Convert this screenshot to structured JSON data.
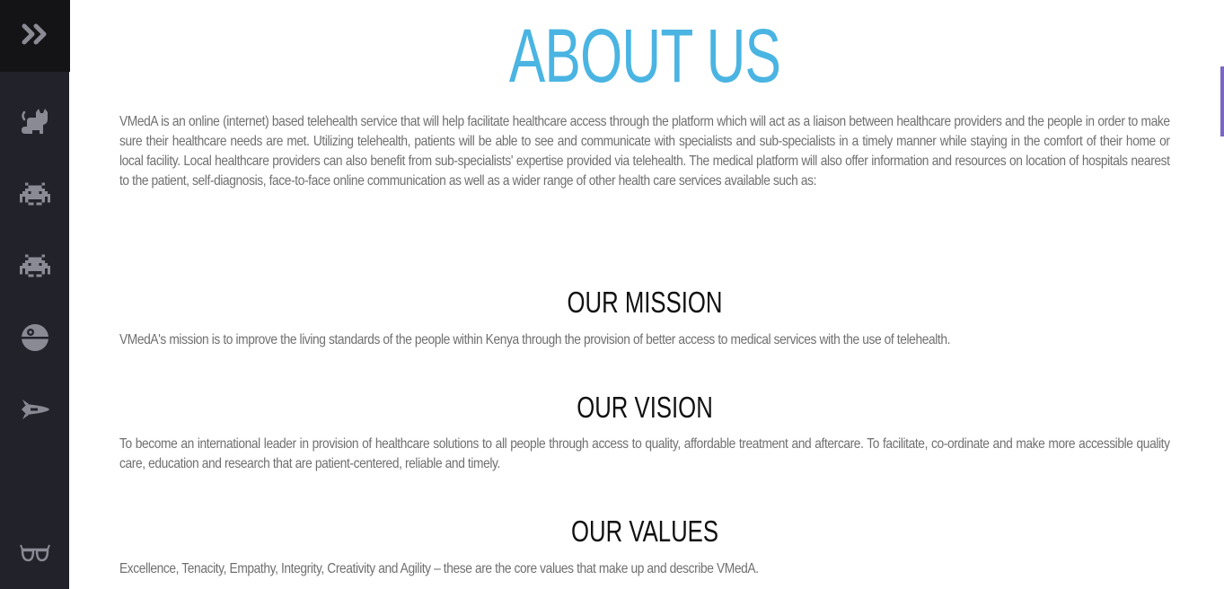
{
  "sidebar": {
    "toggle_icon": "double-chevron-right-icon",
    "items": [
      {
        "name": "cat-icon"
      },
      {
        "name": "space-invader-icon"
      },
      {
        "name": "space-invader-icon"
      },
      {
        "name": "death-star-icon"
      },
      {
        "name": "spaceship-icon"
      },
      {
        "name": "glasses-icon"
      }
    ]
  },
  "page": {
    "title": "ABOUT US",
    "intro": "VMedA is an online (internet) based telehealth service that will help facilitate healthcare access through the platform which will act as a liaison between healthcare providers and the people in order to make sure their healthcare needs are met. Utilizing telehealth, patients will be able to see and communicate with specialists and sub-specialists in a timely manner while staying in the comfort of their home or local facility. Local healthcare providers can also benefit from sub-specialists' expertise provided via telehealth. The medical platform will also offer information and resources on location of hospitals nearest to the patient, self-diagnosis, face-to-face online communication as well as a wider range of other health care services available such as:",
    "mission": {
      "title": "OUR MISSION",
      "text": "VMedA's mission is to improve the living standards of the people within Kenya through the provision of better access to medical services with the use of telehealth."
    },
    "vision": {
      "title": "OUR VISION",
      "text": "To become an international leader in provision of healthcare solutions to all people through access to quality, affordable treatment and aftercare. To facilitate, co-ordinate and make more accessible quality care, education and research that are patient-centered, reliable and timely."
    },
    "values": {
      "title": "OUR VALUES",
      "text": "Excellence, Tenacity, Empathy, Integrity, Creativity and Agility – these are the core values that make up and describe VMedA."
    }
  },
  "colors": {
    "accent": "#4ab4e2",
    "sidebar": "#22222b",
    "sidebar_top": "#141416",
    "icon": "#8a8a94",
    "body_text": "#6f6f6f",
    "heading": "#111111",
    "scroll_thumb": "#7a67c6"
  }
}
